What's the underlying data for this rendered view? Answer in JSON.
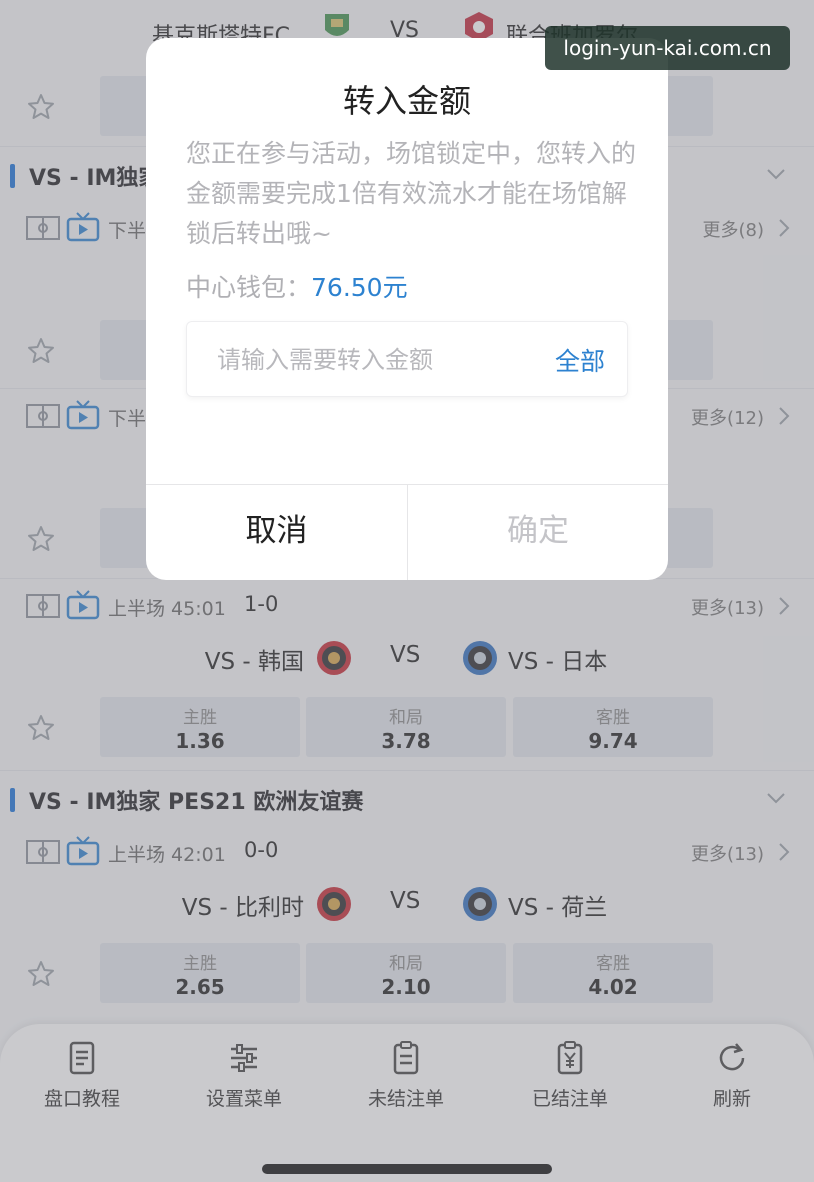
{
  "top_match": {
    "home": "基克斯塔特FC",
    "vs": "VS",
    "away": "联合班加罗尔"
  },
  "leagues": [
    {
      "name": "VS - IM独家",
      "matches": [
        {
          "period": "下半",
          "more": "更多(8)"
        },
        {
          "period": "下半",
          "more": "更多(12)"
        },
        {
          "period": "上半场 45:01",
          "score": "1-0",
          "more": "更多(13)",
          "home": "VS - 韩国",
          "vs": "VS",
          "away": "VS - 日本",
          "odds": [
            {
              "label": "主胜",
              "value": "1.36"
            },
            {
              "label": "和局",
              "value": "3.78"
            },
            {
              "label": "客胜",
              "value": "9.74"
            }
          ]
        }
      ]
    },
    {
      "name": "VS - IM独家 PES21 欧洲友谊赛",
      "matches": [
        {
          "period": "上半场 42:01",
          "score": "0-0",
          "more": "更多(13)",
          "home": "VS - 比利时",
          "vs": "VS",
          "away": "VS - 荷兰",
          "odds": [
            {
              "label": "主胜",
              "value": "2.65"
            },
            {
              "label": "和局",
              "value": "2.10"
            },
            {
              "label": "客胜",
              "value": "4.02"
            }
          ]
        }
      ]
    }
  ],
  "tabbar": {
    "items": [
      {
        "label": "盘口教程",
        "icon": "document-icon"
      },
      {
        "label": "设置菜单",
        "icon": "sliders-icon"
      },
      {
        "label": "未结注单",
        "icon": "clipboard-icon"
      },
      {
        "label": "已结注单",
        "icon": "yen-clipboard-icon"
      },
      {
        "label": "刷新",
        "icon": "refresh-icon"
      }
    ]
  },
  "dialog": {
    "title": "转入金额",
    "message": "您正在参与活动，场馆锁定中，您转入的金额需要完成1倍有效流水才能在场馆解锁后转出哦~",
    "wallet_label": "中心钱包：",
    "wallet_value": "76.50元",
    "amount_placeholder": "请输入需要转入金额",
    "all_label": "全部",
    "cancel_label": "取消",
    "confirm_label": "确定"
  },
  "watermark": "login-yun-kai.com.cn",
  "colors": {
    "accent": "#2d82d0",
    "league_bar": "#1a73d9",
    "odds_bg": "#e2e6ec"
  }
}
